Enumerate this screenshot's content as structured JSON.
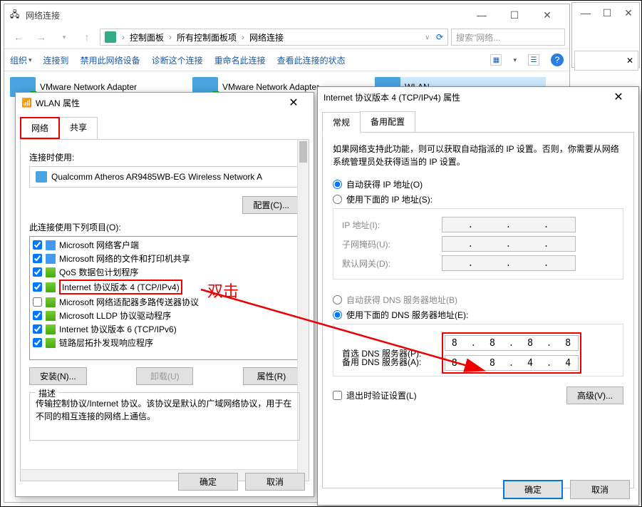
{
  "explorer": {
    "title": "网络连接",
    "breadcrumb": [
      "控制面板",
      "所有控制面板项",
      "网络连接"
    ],
    "search_placeholder": "搜索\"网络...",
    "toolbar": {
      "organize": "组织",
      "connect": "连接到",
      "disable": "禁用此网络设备",
      "diagnose": "诊断这个连接",
      "rename": "重命名此连接",
      "status": "查看此连接的状态"
    },
    "adapters": [
      {
        "name": "VMware Network Adapter"
      },
      {
        "name": "VMware Network Adapter"
      },
      {
        "name": "WLAN"
      }
    ]
  },
  "wlan_props": {
    "title": "WLAN 属性",
    "tabs": {
      "network": "网络",
      "share": "共享"
    },
    "connect_using": "连接时使用:",
    "adapter": "Qualcomm Atheros AR9485WB-EG Wireless Network A",
    "configure_btn": "配置(C)...",
    "items_label": "此连接使用下列项目(O):",
    "items": [
      {
        "checked": true,
        "label": "Microsoft 网络客户端"
      },
      {
        "checked": true,
        "label": "Microsoft 网络的文件和打印机共享"
      },
      {
        "checked": true,
        "label": "QoS 数据包计划程序"
      },
      {
        "checked": true,
        "label": "Internet 协议版本 4 (TCP/IPv4)",
        "highlight": true
      },
      {
        "checked": false,
        "label": "Microsoft 网络适配器多路传送器协议"
      },
      {
        "checked": true,
        "label": "Microsoft LLDP 协议驱动程序"
      },
      {
        "checked": true,
        "label": "Internet 协议版本 6 (TCP/IPv6)"
      },
      {
        "checked": true,
        "label": "链路层拓扑发现响应程序"
      }
    ],
    "install_btn": "安装(N)...",
    "uninstall_btn": "卸载(U)",
    "props_btn": "属性(R)",
    "desc_legend": "描述",
    "desc_text": "传输控制协议/Internet 协议。该协议是默认的广域网络协议，用于在不同的相互连接的网络上通信。",
    "ok": "确定",
    "cancel": "取消"
  },
  "ipv4": {
    "title": "Internet 协议版本 4 (TCP/IPv4) 属性",
    "tabs": {
      "general": "常规",
      "alt": "备用配置"
    },
    "info": "如果网络支持此功能，则可以获取自动指派的 IP 设置。否则，你需要从网络系统管理员处获得适当的 IP 设置。",
    "auto_ip": "自动获得 IP 地址(O)",
    "manual_ip": "使用下面的 IP 地址(S):",
    "ip_label": "IP 地址(I):",
    "mask_label": "子网掩码(U):",
    "gw_label": "默认网关(D):",
    "auto_dns": "自动获得 DNS 服务器地址(B)",
    "manual_dns": "使用下面的 DNS 服务器地址(E):",
    "dns1_label": "首选 DNS 服务器(P):",
    "dns2_label": "备用 DNS 服务器(A):",
    "dns1": [
      "8",
      "8",
      "8",
      "8"
    ],
    "dns2": [
      "8",
      "8",
      "4",
      "4"
    ],
    "validate": "退出时验证设置(L)",
    "advanced": "高级(V)...",
    "ok": "确定",
    "cancel": "取消"
  },
  "annotation": {
    "dbl": "双击"
  }
}
